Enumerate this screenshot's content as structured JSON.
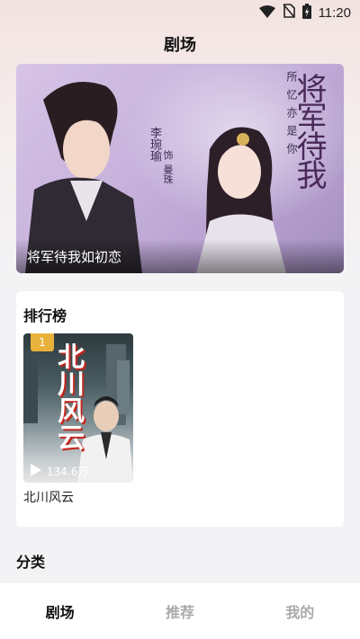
{
  "status_bar": {
    "time": "11:20",
    "icons": [
      "wifi-icon",
      "no-sim-icon",
      "battery-icon"
    ]
  },
  "header": {
    "title": "剧场"
  },
  "banner": {
    "caption": "将军待我如初恋",
    "poster_title": "将军待我",
    "poster_tagline": "所忆亦是你",
    "actor_1": "李琬瑜",
    "actor_role": "饰",
    "actor_2": "曼珠"
  },
  "ranking": {
    "title": "排行榜",
    "items": [
      {
        "rank": "1",
        "cover_text": "北川风云",
        "name": "北川风云",
        "plays": "134.6万"
      }
    ]
  },
  "categories": {
    "title": "分类"
  },
  "bottom_nav": {
    "items": [
      {
        "label": "剧场",
        "active": true
      },
      {
        "label": "推荐",
        "active": false
      },
      {
        "label": "我的",
        "active": false
      }
    ]
  },
  "colors": {
    "accent_badge": "#e8b13a",
    "active_nav": "#111111",
    "inactive_nav": "#aaaaaa"
  }
}
